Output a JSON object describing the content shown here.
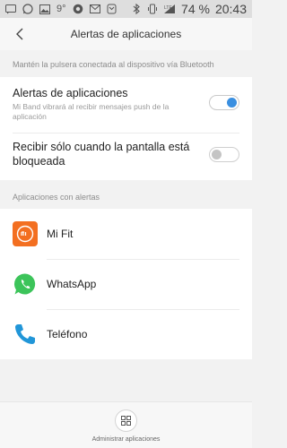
{
  "status_bar": {
    "temperature": "9°",
    "network": "LTE",
    "battery": "74 %",
    "time": "20:43",
    "icons": [
      "message-icon",
      "whatsapp-icon",
      "image-icon",
      "temperature",
      "chrome-icon",
      "gmail-icon",
      "mi-app-icon",
      "bluetooth-icon",
      "vibrate-icon",
      "signal-icon"
    ]
  },
  "header": {
    "title": "Alertas de aplicaciones"
  },
  "hint": "Mantén la pulsera conectada al dispositivo vía Bluetooth",
  "settings": {
    "app_alerts": {
      "label": "Alertas de aplicaciones",
      "description": "Mi Band vibrará al recibir mensajes push de la aplicación",
      "enabled": true
    },
    "locked_only": {
      "label": "Recibir sólo cuando la pantalla está bloqueada",
      "enabled": false
    }
  },
  "section_label": "Aplicaciones con alertas",
  "apps": [
    {
      "name": "Mi Fit",
      "icon": "mi-fit-icon"
    },
    {
      "name": "WhatsApp",
      "icon": "whatsapp-icon"
    },
    {
      "name": "Teléfono",
      "icon": "phone-icon"
    }
  ],
  "bottom": {
    "manage_label": "Administrar aplicaciones"
  },
  "colors": {
    "accent": "#3a8fe0",
    "mi_fit": "#f36f21",
    "whatsapp": "#3cc45a",
    "phone": "#2196d8"
  }
}
